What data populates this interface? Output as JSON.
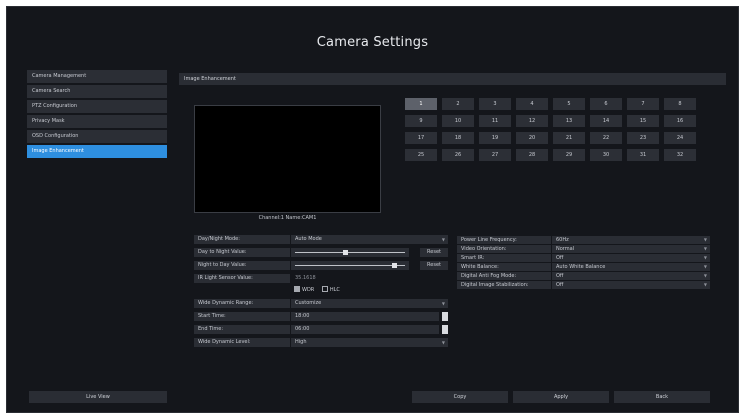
{
  "title": "Camera Settings",
  "menu": [
    {
      "label": "Camera Management",
      "active": false
    },
    {
      "label": "Camera Search",
      "active": false
    },
    {
      "label": "PTZ Configuration",
      "active": false
    },
    {
      "label": "Privacy Mask",
      "active": false
    },
    {
      "label": "OSD Configuration",
      "active": false
    },
    {
      "label": "Image Enhancement",
      "active": true
    }
  ],
  "section_title": "Image Enhancement",
  "preview_caption": "Channel:1 Name:CAM1",
  "channels": [
    "1",
    "2",
    "3",
    "4",
    "5",
    "6",
    "7",
    "8",
    "9",
    "10",
    "11",
    "12",
    "13",
    "14",
    "15",
    "16",
    "17",
    "18",
    "19",
    "20",
    "21",
    "22",
    "23",
    "24",
    "25",
    "26",
    "27",
    "28",
    "29",
    "30",
    "31",
    "32"
  ],
  "selected_channel": "1",
  "left_settings": {
    "day_night_mode": {
      "label": "Day/Night Mode:",
      "value": "Auto Mode"
    },
    "day_to_night": {
      "label": "Day to Night Value:",
      "level": 0.45,
      "reset": "Reset"
    },
    "night_to_day": {
      "label": "Night to Day Value:",
      "level": 0.9,
      "reset": "Reset"
    },
    "ir_sensor": {
      "label": "IR Light Sensor Value:",
      "value": "35.1618"
    },
    "wdr_label": "WDR",
    "wdr_checked": true,
    "hlc_label": "HLC",
    "hlc_checked": false,
    "wdr_range": {
      "label": "Wide Dynamic Range:",
      "value": "Customize"
    },
    "start_time": {
      "label": "Start Time:",
      "value": "18:00"
    },
    "end_time": {
      "label": "End Time:",
      "value": "06:00"
    },
    "wdr_level": {
      "label": "Wide Dynamic Level:",
      "value": "High"
    }
  },
  "right_settings": [
    {
      "label": "Power Line Frequency:",
      "value": "60Hz"
    },
    {
      "label": "Video Orientation:",
      "value": "Normal"
    },
    {
      "label": "Smart IR:",
      "value": "Off"
    },
    {
      "label": "White Balance:",
      "value": "Auto White Balance"
    },
    {
      "label": "Digital Anti Fog Mode:",
      "value": "Off"
    },
    {
      "label": "Digital Image Stabilization:",
      "value": "Off"
    }
  ],
  "buttons": {
    "live_view": "Live View",
    "copy": "Copy",
    "apply": "Apply",
    "back": "Back"
  },
  "colors": {
    "background": "#14161b",
    "panel": "#2a2d34",
    "accent": "#2e8fe0",
    "selected_cell": "#5d616a"
  }
}
